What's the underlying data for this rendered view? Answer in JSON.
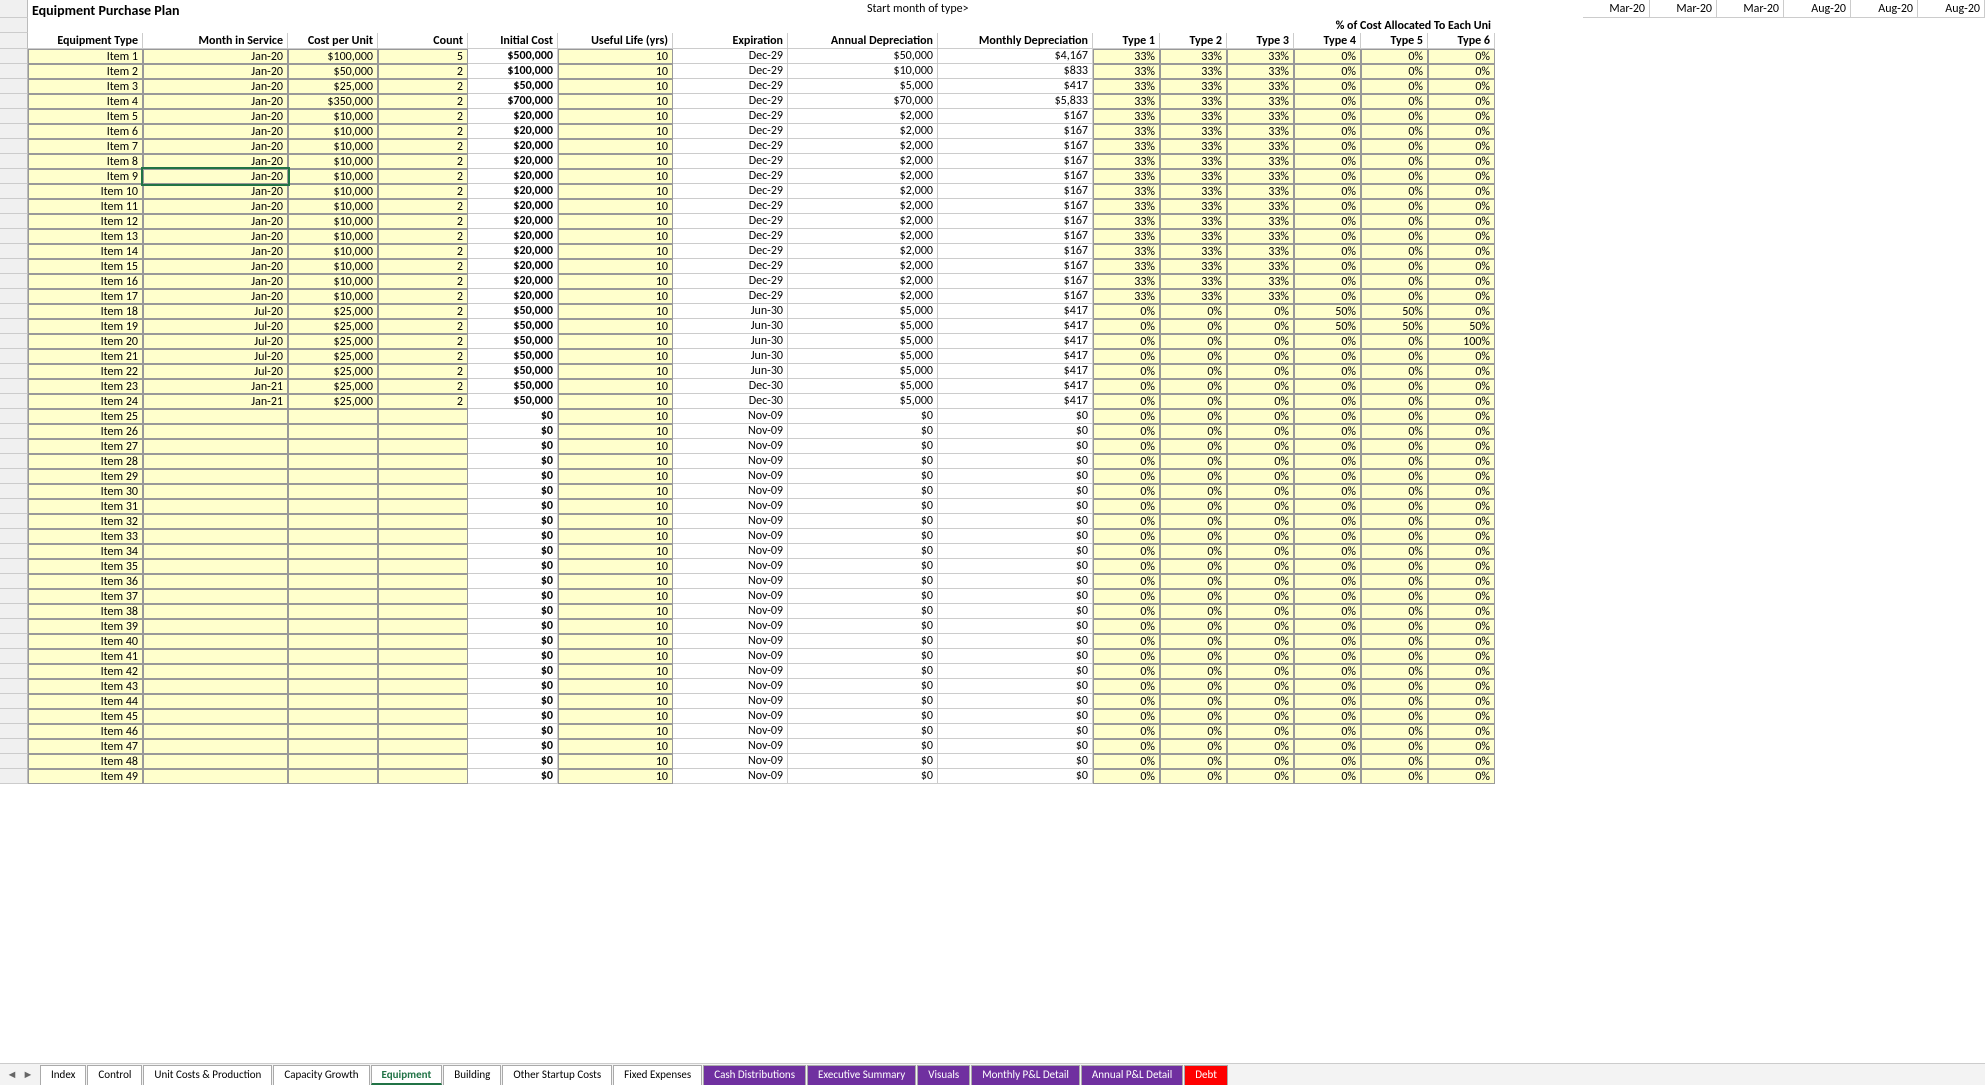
{
  "title": "Equipment Purchase Plan",
  "start_label": "Start month of type>",
  "start_months": [
    "Mar-20",
    "Mar-20",
    "Mar-20",
    "Aug-20",
    "Aug-20",
    "Aug-20"
  ],
  "alloc_label": "% of Cost Allocated To Each Uni",
  "headers": {
    "eq": "Equipment Type",
    "month": "Month in Service",
    "cpu": "Cost per Unit",
    "count": "Count",
    "init": "Initial Cost",
    "life": "Useful Life (yrs)",
    "exp": "Expiration",
    "ann": "Annual Depreciation",
    "mon": "Monthly Depreciation",
    "types": [
      "Type 1",
      "Type 2",
      "Type 3",
      "Type 4",
      "Type 5",
      "Type 6"
    ]
  },
  "rows": [
    {
      "eq": "Item 1",
      "month": "Jan-20",
      "cpu": "$100,000",
      "count": "5",
      "init": "$500,000",
      "life": "10",
      "exp": "Dec-29",
      "ann": "$50,000",
      "mon": "$4,167",
      "t": [
        "33%",
        "33%",
        "33%",
        "0%",
        "0%",
        "0%"
      ]
    },
    {
      "eq": "Item 2",
      "month": "Jan-20",
      "cpu": "$50,000",
      "count": "2",
      "init": "$100,000",
      "life": "10",
      "exp": "Dec-29",
      "ann": "$10,000",
      "mon": "$833",
      "t": [
        "33%",
        "33%",
        "33%",
        "0%",
        "0%",
        "0%"
      ]
    },
    {
      "eq": "Item 3",
      "month": "Jan-20",
      "cpu": "$25,000",
      "count": "2",
      "init": "$50,000",
      "life": "10",
      "exp": "Dec-29",
      "ann": "$5,000",
      "mon": "$417",
      "t": [
        "33%",
        "33%",
        "33%",
        "0%",
        "0%",
        "0%"
      ]
    },
    {
      "eq": "Item 4",
      "month": "Jan-20",
      "cpu": "$350,000",
      "count": "2",
      "init": "$700,000",
      "life": "10",
      "exp": "Dec-29",
      "ann": "$70,000",
      "mon": "$5,833",
      "t": [
        "33%",
        "33%",
        "33%",
        "0%",
        "0%",
        "0%"
      ]
    },
    {
      "eq": "Item 5",
      "month": "Jan-20",
      "cpu": "$10,000",
      "count": "2",
      "init": "$20,000",
      "life": "10",
      "exp": "Dec-29",
      "ann": "$2,000",
      "mon": "$167",
      "t": [
        "33%",
        "33%",
        "33%",
        "0%",
        "0%",
        "0%"
      ]
    },
    {
      "eq": "Item 6",
      "month": "Jan-20",
      "cpu": "$10,000",
      "count": "2",
      "init": "$20,000",
      "life": "10",
      "exp": "Dec-29",
      "ann": "$2,000",
      "mon": "$167",
      "t": [
        "33%",
        "33%",
        "33%",
        "0%",
        "0%",
        "0%"
      ]
    },
    {
      "eq": "Item 7",
      "month": "Jan-20",
      "cpu": "$10,000",
      "count": "2",
      "init": "$20,000",
      "life": "10",
      "exp": "Dec-29",
      "ann": "$2,000",
      "mon": "$167",
      "t": [
        "33%",
        "33%",
        "33%",
        "0%",
        "0%",
        "0%"
      ]
    },
    {
      "eq": "Item 8",
      "month": "Jan-20",
      "cpu": "$10,000",
      "count": "2",
      "init": "$20,000",
      "life": "10",
      "exp": "Dec-29",
      "ann": "$2,000",
      "mon": "$167",
      "t": [
        "33%",
        "33%",
        "33%",
        "0%",
        "0%",
        "0%"
      ]
    },
    {
      "eq": "Item 9",
      "month": "Jan-20",
      "cpu": "$10,000",
      "count": "2",
      "init": "$20,000",
      "life": "10",
      "exp": "Dec-29",
      "ann": "$2,000",
      "mon": "$167",
      "t": [
        "33%",
        "33%",
        "33%",
        "0%",
        "0%",
        "0%"
      ]
    },
    {
      "eq": "Item 10",
      "month": "Jan-20",
      "cpu": "$10,000",
      "count": "2",
      "init": "$20,000",
      "life": "10",
      "exp": "Dec-29",
      "ann": "$2,000",
      "mon": "$167",
      "t": [
        "33%",
        "33%",
        "33%",
        "0%",
        "0%",
        "0%"
      ]
    },
    {
      "eq": "Item 11",
      "month": "Jan-20",
      "cpu": "$10,000",
      "count": "2",
      "init": "$20,000",
      "life": "10",
      "exp": "Dec-29",
      "ann": "$2,000",
      "mon": "$167",
      "t": [
        "33%",
        "33%",
        "33%",
        "0%",
        "0%",
        "0%"
      ]
    },
    {
      "eq": "Item 12",
      "month": "Jan-20",
      "cpu": "$10,000",
      "count": "2",
      "init": "$20,000",
      "life": "10",
      "exp": "Dec-29",
      "ann": "$2,000",
      "mon": "$167",
      "t": [
        "33%",
        "33%",
        "33%",
        "0%",
        "0%",
        "0%"
      ]
    },
    {
      "eq": "Item 13",
      "month": "Jan-20",
      "cpu": "$10,000",
      "count": "2",
      "init": "$20,000",
      "life": "10",
      "exp": "Dec-29",
      "ann": "$2,000",
      "mon": "$167",
      "t": [
        "33%",
        "33%",
        "33%",
        "0%",
        "0%",
        "0%"
      ]
    },
    {
      "eq": "Item 14",
      "month": "Jan-20",
      "cpu": "$10,000",
      "count": "2",
      "init": "$20,000",
      "life": "10",
      "exp": "Dec-29",
      "ann": "$2,000",
      "mon": "$167",
      "t": [
        "33%",
        "33%",
        "33%",
        "0%",
        "0%",
        "0%"
      ]
    },
    {
      "eq": "Item 15",
      "month": "Jan-20",
      "cpu": "$10,000",
      "count": "2",
      "init": "$20,000",
      "life": "10",
      "exp": "Dec-29",
      "ann": "$2,000",
      "mon": "$167",
      "t": [
        "33%",
        "33%",
        "33%",
        "0%",
        "0%",
        "0%"
      ]
    },
    {
      "eq": "Item 16",
      "month": "Jan-20",
      "cpu": "$10,000",
      "count": "2",
      "init": "$20,000",
      "life": "10",
      "exp": "Dec-29",
      "ann": "$2,000",
      "mon": "$167",
      "t": [
        "33%",
        "33%",
        "33%",
        "0%",
        "0%",
        "0%"
      ]
    },
    {
      "eq": "Item 17",
      "month": "Jan-20",
      "cpu": "$10,000",
      "count": "2",
      "init": "$20,000",
      "life": "10",
      "exp": "Dec-29",
      "ann": "$2,000",
      "mon": "$167",
      "t": [
        "33%",
        "33%",
        "33%",
        "0%",
        "0%",
        "0%"
      ]
    },
    {
      "eq": "Item 18",
      "month": "Jul-20",
      "cpu": "$25,000",
      "count": "2",
      "init": "$50,000",
      "life": "10",
      "exp": "Jun-30",
      "ann": "$5,000",
      "mon": "$417",
      "t": [
        "0%",
        "0%",
        "0%",
        "50%",
        "50%",
        "0%"
      ]
    },
    {
      "eq": "Item 19",
      "month": "Jul-20",
      "cpu": "$25,000",
      "count": "2",
      "init": "$50,000",
      "life": "10",
      "exp": "Jun-30",
      "ann": "$5,000",
      "mon": "$417",
      "t": [
        "0%",
        "0%",
        "0%",
        "50%",
        "50%",
        "50%"
      ]
    },
    {
      "eq": "Item 20",
      "month": "Jul-20",
      "cpu": "$25,000",
      "count": "2",
      "init": "$50,000",
      "life": "10",
      "exp": "Jun-30",
      "ann": "$5,000",
      "mon": "$417",
      "t": [
        "0%",
        "0%",
        "0%",
        "0%",
        "0%",
        "100%"
      ]
    },
    {
      "eq": "Item 21",
      "month": "Jul-20",
      "cpu": "$25,000",
      "count": "2",
      "init": "$50,000",
      "life": "10",
      "exp": "Jun-30",
      "ann": "$5,000",
      "mon": "$417",
      "t": [
        "0%",
        "0%",
        "0%",
        "0%",
        "0%",
        "0%"
      ]
    },
    {
      "eq": "Item 22",
      "month": "Jul-20",
      "cpu": "$25,000",
      "count": "2",
      "init": "$50,000",
      "life": "10",
      "exp": "Jun-30",
      "ann": "$5,000",
      "mon": "$417",
      "t": [
        "0%",
        "0%",
        "0%",
        "0%",
        "0%",
        "0%"
      ]
    },
    {
      "eq": "Item 23",
      "month": "Jan-21",
      "cpu": "$25,000",
      "count": "2",
      "init": "$50,000",
      "life": "10",
      "exp": "Dec-30",
      "ann": "$5,000",
      "mon": "$417",
      "t": [
        "0%",
        "0%",
        "0%",
        "0%",
        "0%",
        "0%"
      ]
    },
    {
      "eq": "Item 24",
      "month": "Jan-21",
      "cpu": "$25,000",
      "count": "2",
      "init": "$50,000",
      "life": "10",
      "exp": "Dec-30",
      "ann": "$5,000",
      "mon": "$417",
      "t": [
        "0%",
        "0%",
        "0%",
        "0%",
        "0%",
        "0%"
      ]
    },
    {
      "eq": "Item 25",
      "month": "",
      "cpu": "",
      "count": "",
      "init": "$0",
      "life": "10",
      "exp": "Nov-09",
      "ann": "$0",
      "mon": "$0",
      "t": [
        "0%",
        "0%",
        "0%",
        "0%",
        "0%",
        "0%"
      ]
    },
    {
      "eq": "Item 26",
      "month": "",
      "cpu": "",
      "count": "",
      "init": "$0",
      "life": "10",
      "exp": "Nov-09",
      "ann": "$0",
      "mon": "$0",
      "t": [
        "0%",
        "0%",
        "0%",
        "0%",
        "0%",
        "0%"
      ]
    },
    {
      "eq": "Item 27",
      "month": "",
      "cpu": "",
      "count": "",
      "init": "$0",
      "life": "10",
      "exp": "Nov-09",
      "ann": "$0",
      "mon": "$0",
      "t": [
        "0%",
        "0%",
        "0%",
        "0%",
        "0%",
        "0%"
      ]
    },
    {
      "eq": "Item 28",
      "month": "",
      "cpu": "",
      "count": "",
      "init": "$0",
      "life": "10",
      "exp": "Nov-09",
      "ann": "$0",
      "mon": "$0",
      "t": [
        "0%",
        "0%",
        "0%",
        "0%",
        "0%",
        "0%"
      ]
    },
    {
      "eq": "Item 29",
      "month": "",
      "cpu": "",
      "count": "",
      "init": "$0",
      "life": "10",
      "exp": "Nov-09",
      "ann": "$0",
      "mon": "$0",
      "t": [
        "0%",
        "0%",
        "0%",
        "0%",
        "0%",
        "0%"
      ]
    },
    {
      "eq": "Item 30",
      "month": "",
      "cpu": "",
      "count": "",
      "init": "$0",
      "life": "10",
      "exp": "Nov-09",
      "ann": "$0",
      "mon": "$0",
      "t": [
        "0%",
        "0%",
        "0%",
        "0%",
        "0%",
        "0%"
      ]
    },
    {
      "eq": "Item 31",
      "month": "",
      "cpu": "",
      "count": "",
      "init": "$0",
      "life": "10",
      "exp": "Nov-09",
      "ann": "$0",
      "mon": "$0",
      "t": [
        "0%",
        "0%",
        "0%",
        "0%",
        "0%",
        "0%"
      ]
    },
    {
      "eq": "Item 32",
      "month": "",
      "cpu": "",
      "count": "",
      "init": "$0",
      "life": "10",
      "exp": "Nov-09",
      "ann": "$0",
      "mon": "$0",
      "t": [
        "0%",
        "0%",
        "0%",
        "0%",
        "0%",
        "0%"
      ]
    },
    {
      "eq": "Item 33",
      "month": "",
      "cpu": "",
      "count": "",
      "init": "$0",
      "life": "10",
      "exp": "Nov-09",
      "ann": "$0",
      "mon": "$0",
      "t": [
        "0%",
        "0%",
        "0%",
        "0%",
        "0%",
        "0%"
      ]
    },
    {
      "eq": "Item 34",
      "month": "",
      "cpu": "",
      "count": "",
      "init": "$0",
      "life": "10",
      "exp": "Nov-09",
      "ann": "$0",
      "mon": "$0",
      "t": [
        "0%",
        "0%",
        "0%",
        "0%",
        "0%",
        "0%"
      ]
    },
    {
      "eq": "Item 35",
      "month": "",
      "cpu": "",
      "count": "",
      "init": "$0",
      "life": "10",
      "exp": "Nov-09",
      "ann": "$0",
      "mon": "$0",
      "t": [
        "0%",
        "0%",
        "0%",
        "0%",
        "0%",
        "0%"
      ]
    },
    {
      "eq": "Item 36",
      "month": "",
      "cpu": "",
      "count": "",
      "init": "$0",
      "life": "10",
      "exp": "Nov-09",
      "ann": "$0",
      "mon": "$0",
      "t": [
        "0%",
        "0%",
        "0%",
        "0%",
        "0%",
        "0%"
      ]
    },
    {
      "eq": "Item 37",
      "month": "",
      "cpu": "",
      "count": "",
      "init": "$0",
      "life": "10",
      "exp": "Nov-09",
      "ann": "$0",
      "mon": "$0",
      "t": [
        "0%",
        "0%",
        "0%",
        "0%",
        "0%",
        "0%"
      ]
    },
    {
      "eq": "Item 38",
      "month": "",
      "cpu": "",
      "count": "",
      "init": "$0",
      "life": "10",
      "exp": "Nov-09",
      "ann": "$0",
      "mon": "$0",
      "t": [
        "0%",
        "0%",
        "0%",
        "0%",
        "0%",
        "0%"
      ]
    },
    {
      "eq": "Item 39",
      "month": "",
      "cpu": "",
      "count": "",
      "init": "$0",
      "life": "10",
      "exp": "Nov-09",
      "ann": "$0",
      "mon": "$0",
      "t": [
        "0%",
        "0%",
        "0%",
        "0%",
        "0%",
        "0%"
      ]
    },
    {
      "eq": "Item 40",
      "month": "",
      "cpu": "",
      "count": "",
      "init": "$0",
      "life": "10",
      "exp": "Nov-09",
      "ann": "$0",
      "mon": "$0",
      "t": [
        "0%",
        "0%",
        "0%",
        "0%",
        "0%",
        "0%"
      ]
    },
    {
      "eq": "Item 41",
      "month": "",
      "cpu": "",
      "count": "",
      "init": "$0",
      "life": "10",
      "exp": "Nov-09",
      "ann": "$0",
      "mon": "$0",
      "t": [
        "0%",
        "0%",
        "0%",
        "0%",
        "0%",
        "0%"
      ]
    },
    {
      "eq": "Item 42",
      "month": "",
      "cpu": "",
      "count": "",
      "init": "$0",
      "life": "10",
      "exp": "Nov-09",
      "ann": "$0",
      "mon": "$0",
      "t": [
        "0%",
        "0%",
        "0%",
        "0%",
        "0%",
        "0%"
      ]
    },
    {
      "eq": "Item 43",
      "month": "",
      "cpu": "",
      "count": "",
      "init": "$0",
      "life": "10",
      "exp": "Nov-09",
      "ann": "$0",
      "mon": "$0",
      "t": [
        "0%",
        "0%",
        "0%",
        "0%",
        "0%",
        "0%"
      ]
    },
    {
      "eq": "Item 44",
      "month": "",
      "cpu": "",
      "count": "",
      "init": "$0",
      "life": "10",
      "exp": "Nov-09",
      "ann": "$0",
      "mon": "$0",
      "t": [
        "0%",
        "0%",
        "0%",
        "0%",
        "0%",
        "0%"
      ]
    },
    {
      "eq": "Item 45",
      "month": "",
      "cpu": "",
      "count": "",
      "init": "$0",
      "life": "10",
      "exp": "Nov-09",
      "ann": "$0",
      "mon": "$0",
      "t": [
        "0%",
        "0%",
        "0%",
        "0%",
        "0%",
        "0%"
      ]
    },
    {
      "eq": "Item 46",
      "month": "",
      "cpu": "",
      "count": "",
      "init": "$0",
      "life": "10",
      "exp": "Nov-09",
      "ann": "$0",
      "mon": "$0",
      "t": [
        "0%",
        "0%",
        "0%",
        "0%",
        "0%",
        "0%"
      ]
    },
    {
      "eq": "Item 47",
      "month": "",
      "cpu": "",
      "count": "",
      "init": "$0",
      "life": "10",
      "exp": "Nov-09",
      "ann": "$0",
      "mon": "$0",
      "t": [
        "0%",
        "0%",
        "0%",
        "0%",
        "0%",
        "0%"
      ]
    },
    {
      "eq": "Item 48",
      "month": "",
      "cpu": "",
      "count": "",
      "init": "$0",
      "life": "10",
      "exp": "Nov-09",
      "ann": "$0",
      "mon": "$0",
      "t": [
        "0%",
        "0%",
        "0%",
        "0%",
        "0%",
        "0%"
      ]
    },
    {
      "eq": "Item 49",
      "month": "",
      "cpu": "",
      "count": "",
      "init": "$0",
      "life": "10",
      "exp": "Nov-09",
      "ann": "$0",
      "mon": "$0",
      "t": [
        "0%",
        "0%",
        "0%",
        "0%",
        "0%",
        "0%"
      ]
    }
  ],
  "tabs": [
    {
      "label": "Index",
      "cls": ""
    },
    {
      "label": "Control",
      "cls": ""
    },
    {
      "label": "Unit Costs & Production",
      "cls": ""
    },
    {
      "label": "Capacity Growth",
      "cls": ""
    },
    {
      "label": "Equipment",
      "cls": "active"
    },
    {
      "label": "Building",
      "cls": ""
    },
    {
      "label": "Other Startup Costs",
      "cls": ""
    },
    {
      "label": "Fixed Expenses",
      "cls": ""
    },
    {
      "label": "Cash Distributions",
      "cls": "purple"
    },
    {
      "label": "Executive Summary",
      "cls": "purple"
    },
    {
      "label": "Visuals",
      "cls": "purple"
    },
    {
      "label": "Monthly P&L Detail",
      "cls": "purple"
    },
    {
      "label": "Annual P&L Detail",
      "cls": "purple"
    },
    {
      "label": "Debt",
      "cls": "red"
    }
  ]
}
